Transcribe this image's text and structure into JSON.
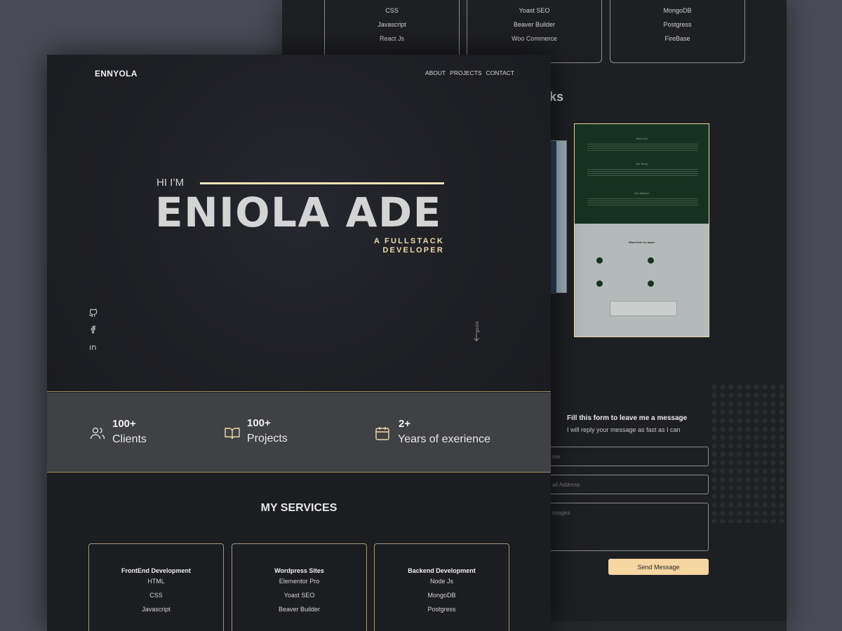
{
  "back": {
    "skill_cards": [
      {
        "items": [
          "CSS",
          "Javascript",
          "React Js"
        ]
      },
      {
        "items": [
          "Yoast SEO",
          "Beaver Builder",
          "Woo Commerce"
        ]
      },
      {
        "items": [
          "MongoDB",
          "Postgress",
          "FireBase"
        ]
      }
    ],
    "works_heading": "ks",
    "mock": {
      "top_titles": [
        "About Us",
        "Our Story",
        "Our Mission"
      ],
      "bottom_title": "What Sets Us Apart"
    },
    "form": {
      "title": "Fill this form to leave me a message",
      "subtitle": "I will reply your message as fast as I can",
      "name_placeholder": "me",
      "email_placeholder": "ail Address",
      "message_placeholder": "ssages",
      "send_label": "Send Message"
    }
  },
  "front": {
    "logo": "ENNYOLA",
    "nav": [
      "ABOUT",
      "PROJECTS",
      "CONTACT"
    ],
    "hero": {
      "greeting": "HI I’M",
      "name": "ENIOLA ADE",
      "role_line1": "A FULLSTACK",
      "role_line2": "DEVELOPER",
      "scroll_label": "scroll"
    },
    "social_icons": [
      "github-icon",
      "facebook-icon",
      "linkedin-icon"
    ],
    "stats": [
      {
        "icon": "users-icon",
        "number": "100+",
        "label": "Clients"
      },
      {
        "icon": "book-icon",
        "number": "100+",
        "label": "Projects"
      },
      {
        "icon": "calendar-icon",
        "number": "2+",
        "label": "Years of exerience"
      }
    ],
    "services_title": "MY SERVICES",
    "services": [
      {
        "title": "FrontEnd Development",
        "items": [
          "HTML",
          "CSS",
          "Javascript"
        ]
      },
      {
        "title": "Wordpress Sites",
        "items": [
          "Elementor Pro",
          "Yoast SEO",
          "Beaver Builder"
        ]
      },
      {
        "title": "Backend Development",
        "items": [
          "Node Js",
          "MongoDB",
          "Postgress"
        ]
      }
    ]
  },
  "colors": {
    "background": "#4a4b57",
    "panel": "#1c1d21",
    "accent": "#f1d9a5",
    "stats_band": "#404144",
    "button": "#f6d6a1"
  }
}
